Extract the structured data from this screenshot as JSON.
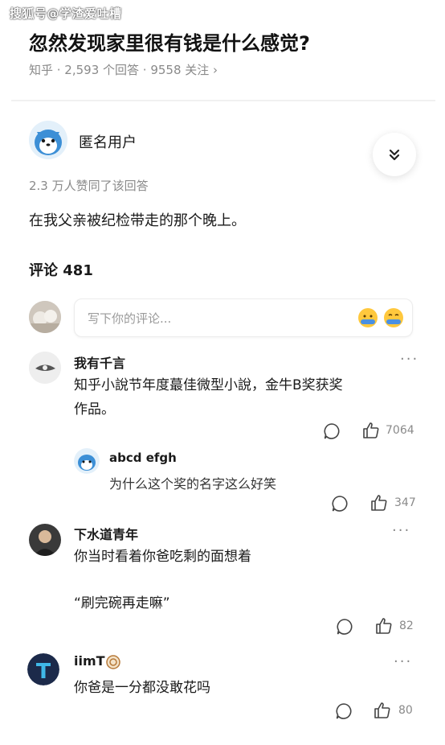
{
  "watermark": "搜狐号@学渣爱吐槽",
  "question": {
    "title": "忽然发现家里很有钱是什么感觉?",
    "meta": "知乎 · 2,593 个回答 · 9558 关注 ›"
  },
  "answer": {
    "author": "匿名用户",
    "likes_text": "2.3 万人赞同了该回答",
    "content": "在我父亲被纪检带走的那个晚上。"
  },
  "comments": {
    "header": "评论 481",
    "input_placeholder": "写下你的评论...",
    "items": [
      {
        "name": "我有千言",
        "text_line1": "知乎小說节年度蕞佳微型小說，金牛B奖获奖",
        "text_line2": "作品。",
        "likes": "7064",
        "reply": {
          "name": "abcd efgh",
          "text": "为什么这个奖的名字这么好笑",
          "likes": "347"
        }
      },
      {
        "name": "下水道青年",
        "text_line1": "你当时看着你爸吃剩的面想着",
        "text_line2": "“刷完碗再走嘛”",
        "likes": "82"
      },
      {
        "name": "iimT",
        "text_line1": "你爸是一分都没敢花吗",
        "likes": "80"
      }
    ]
  },
  "colors": {
    "text_primary": "#1a1a1a",
    "text_secondary": "#8a8a8a",
    "divider": "#f0f0f0",
    "avatar_blue": "#3c8fd6"
  }
}
